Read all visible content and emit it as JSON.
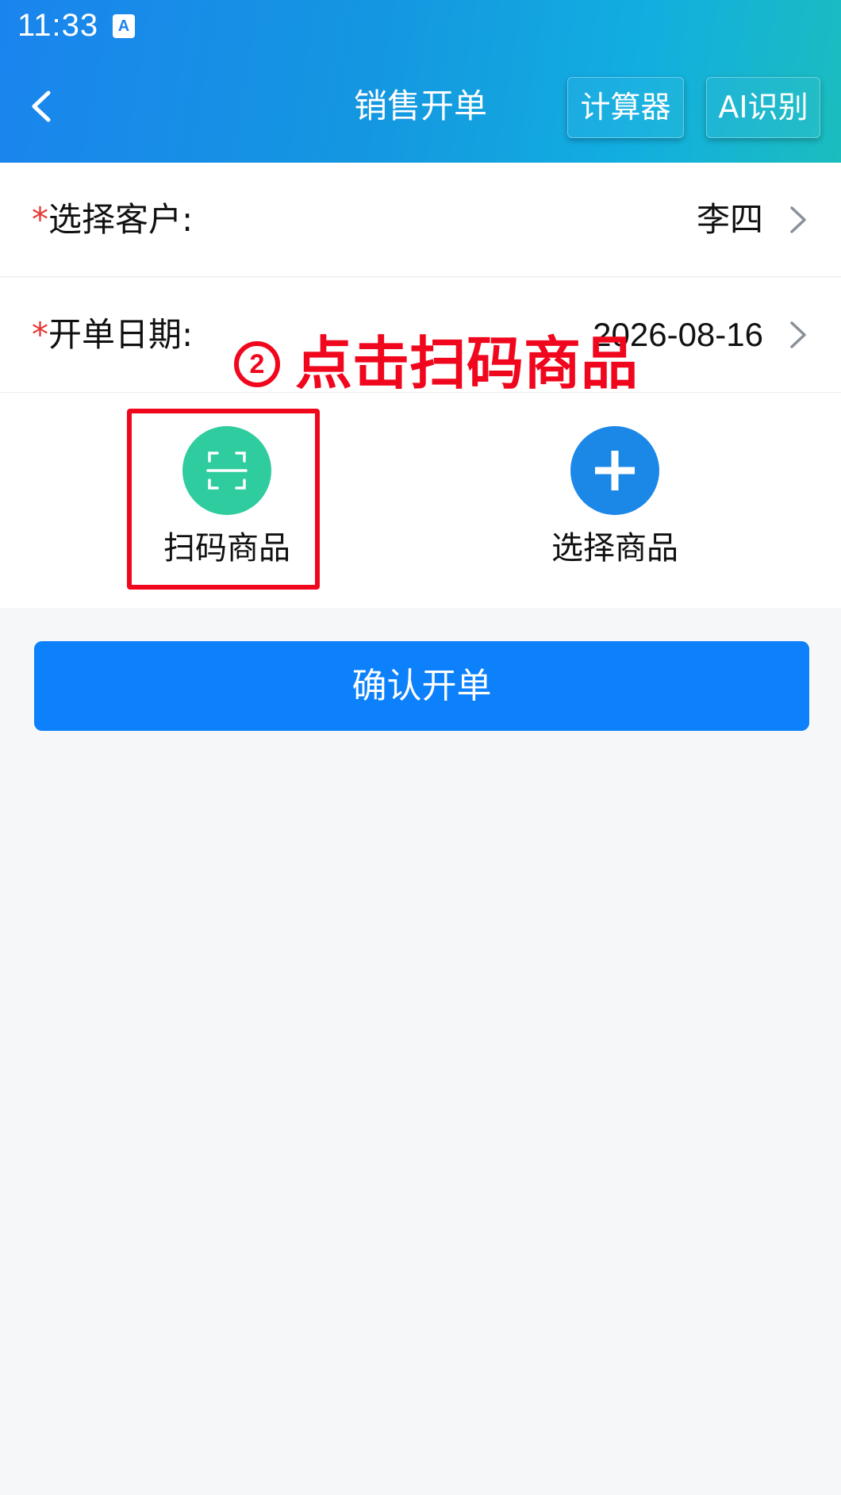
{
  "status_bar": {
    "time": "11:33",
    "app_icon_letter": "A"
  },
  "header": {
    "title": "销售开单",
    "back_icon": "chevron-left-icon",
    "calculator_label": "计算器",
    "ai_label": "AI识别"
  },
  "form": {
    "customer": {
      "required_mark": "*",
      "label": "选择客户:",
      "value": "李四"
    },
    "date": {
      "required_mark": "*",
      "label": "开单日期:",
      "value": "2026-08-16"
    }
  },
  "actions": {
    "scan": {
      "label": "扫码商品",
      "icon": "scan-icon",
      "color": "#2ecc9e"
    },
    "pick": {
      "label": "选择商品",
      "icon": "plus-icon",
      "color": "#1b88e8"
    }
  },
  "confirm_label": "确认开单",
  "annotation": {
    "step": "2",
    "text": "点击扫码商品",
    "color": "#f0071d"
  },
  "colors": {
    "primary": "#0d80fb",
    "required": "#e53935",
    "background": "#f6f7f9"
  }
}
